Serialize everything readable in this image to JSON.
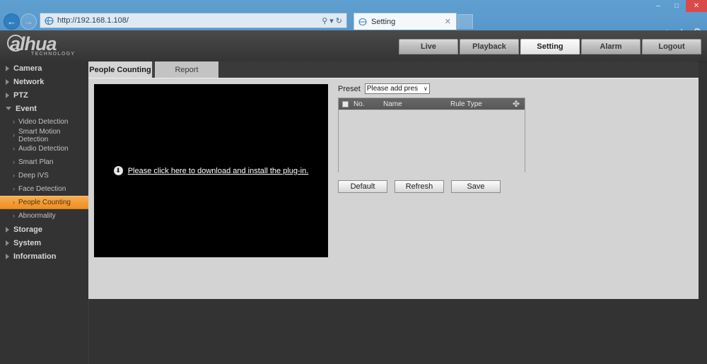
{
  "browser": {
    "window_controls": {
      "minimize": "–",
      "restore": "□",
      "close": "✕"
    },
    "back_icon": "←",
    "forward_icon": "→",
    "address": {
      "url": "http://192.168.1.108/",
      "scheme": "http://",
      "host": "192.168.1.108",
      "path": "/"
    },
    "address_icons": {
      "search": "⚲",
      "dropdown": "▾",
      "refresh": "↻"
    },
    "tab": {
      "title": "Setting",
      "close": "✕"
    },
    "tools": {
      "home": "⌂",
      "favorites": "★",
      "settings": "⚙"
    }
  },
  "header": {
    "logo": {
      "text": "alhua",
      "subtitle": "TECHNOLOGY"
    },
    "nav": [
      {
        "label": "Live",
        "active": false
      },
      {
        "label": "Playback",
        "active": false
      },
      {
        "label": "Setting",
        "active": true
      },
      {
        "label": "Alarm",
        "active": false
      },
      {
        "label": "Logout",
        "active": false
      }
    ]
  },
  "sidebar": {
    "items": [
      {
        "label": "Camera",
        "type": "group",
        "expanded": false
      },
      {
        "label": "Network",
        "type": "group",
        "expanded": false
      },
      {
        "label": "PTZ",
        "type": "group",
        "expanded": false
      },
      {
        "label": "Event",
        "type": "group",
        "expanded": true
      },
      {
        "label": "Video Detection",
        "type": "sub",
        "selected": false
      },
      {
        "label": "Smart Motion Detection",
        "type": "sub",
        "selected": false
      },
      {
        "label": "Audio Detection",
        "type": "sub",
        "selected": false
      },
      {
        "label": "Smart Plan",
        "type": "sub",
        "selected": false
      },
      {
        "label": "Deep IVS",
        "type": "sub",
        "selected": false
      },
      {
        "label": "Face Detection",
        "type": "sub",
        "selected": false
      },
      {
        "label": "People Counting",
        "type": "sub",
        "selected": true
      },
      {
        "label": "Abnormality",
        "type": "sub",
        "selected": false
      },
      {
        "label": "Storage",
        "type": "group",
        "expanded": false
      },
      {
        "label": "System",
        "type": "group",
        "expanded": false
      },
      {
        "label": "Information",
        "type": "group",
        "expanded": false
      }
    ],
    "chevron_icon": "›"
  },
  "content": {
    "tabs": [
      {
        "label": "People Counting",
        "active": true
      },
      {
        "label": "Report",
        "active": false
      }
    ],
    "video": {
      "plugin_message": "Please click here to download and install the plug-in.",
      "download_icon": "⬇"
    },
    "preset": {
      "label": "Preset",
      "selected": "Please add pres",
      "caret": "∨"
    },
    "rule_table": {
      "columns": [
        "No.",
        "Name",
        "Rule Type"
      ],
      "add_icon": "✤",
      "rows": []
    },
    "buttons": [
      {
        "label": "Default"
      },
      {
        "label": "Refresh"
      },
      {
        "label": "Save"
      }
    ]
  },
  "colors": {
    "accent_orange": "#ef8f22",
    "page_background": "#333333",
    "panel_background": "#d3d3d3",
    "browser_chrome": "#5b9bcd",
    "close_button": "#d94a4a"
  }
}
